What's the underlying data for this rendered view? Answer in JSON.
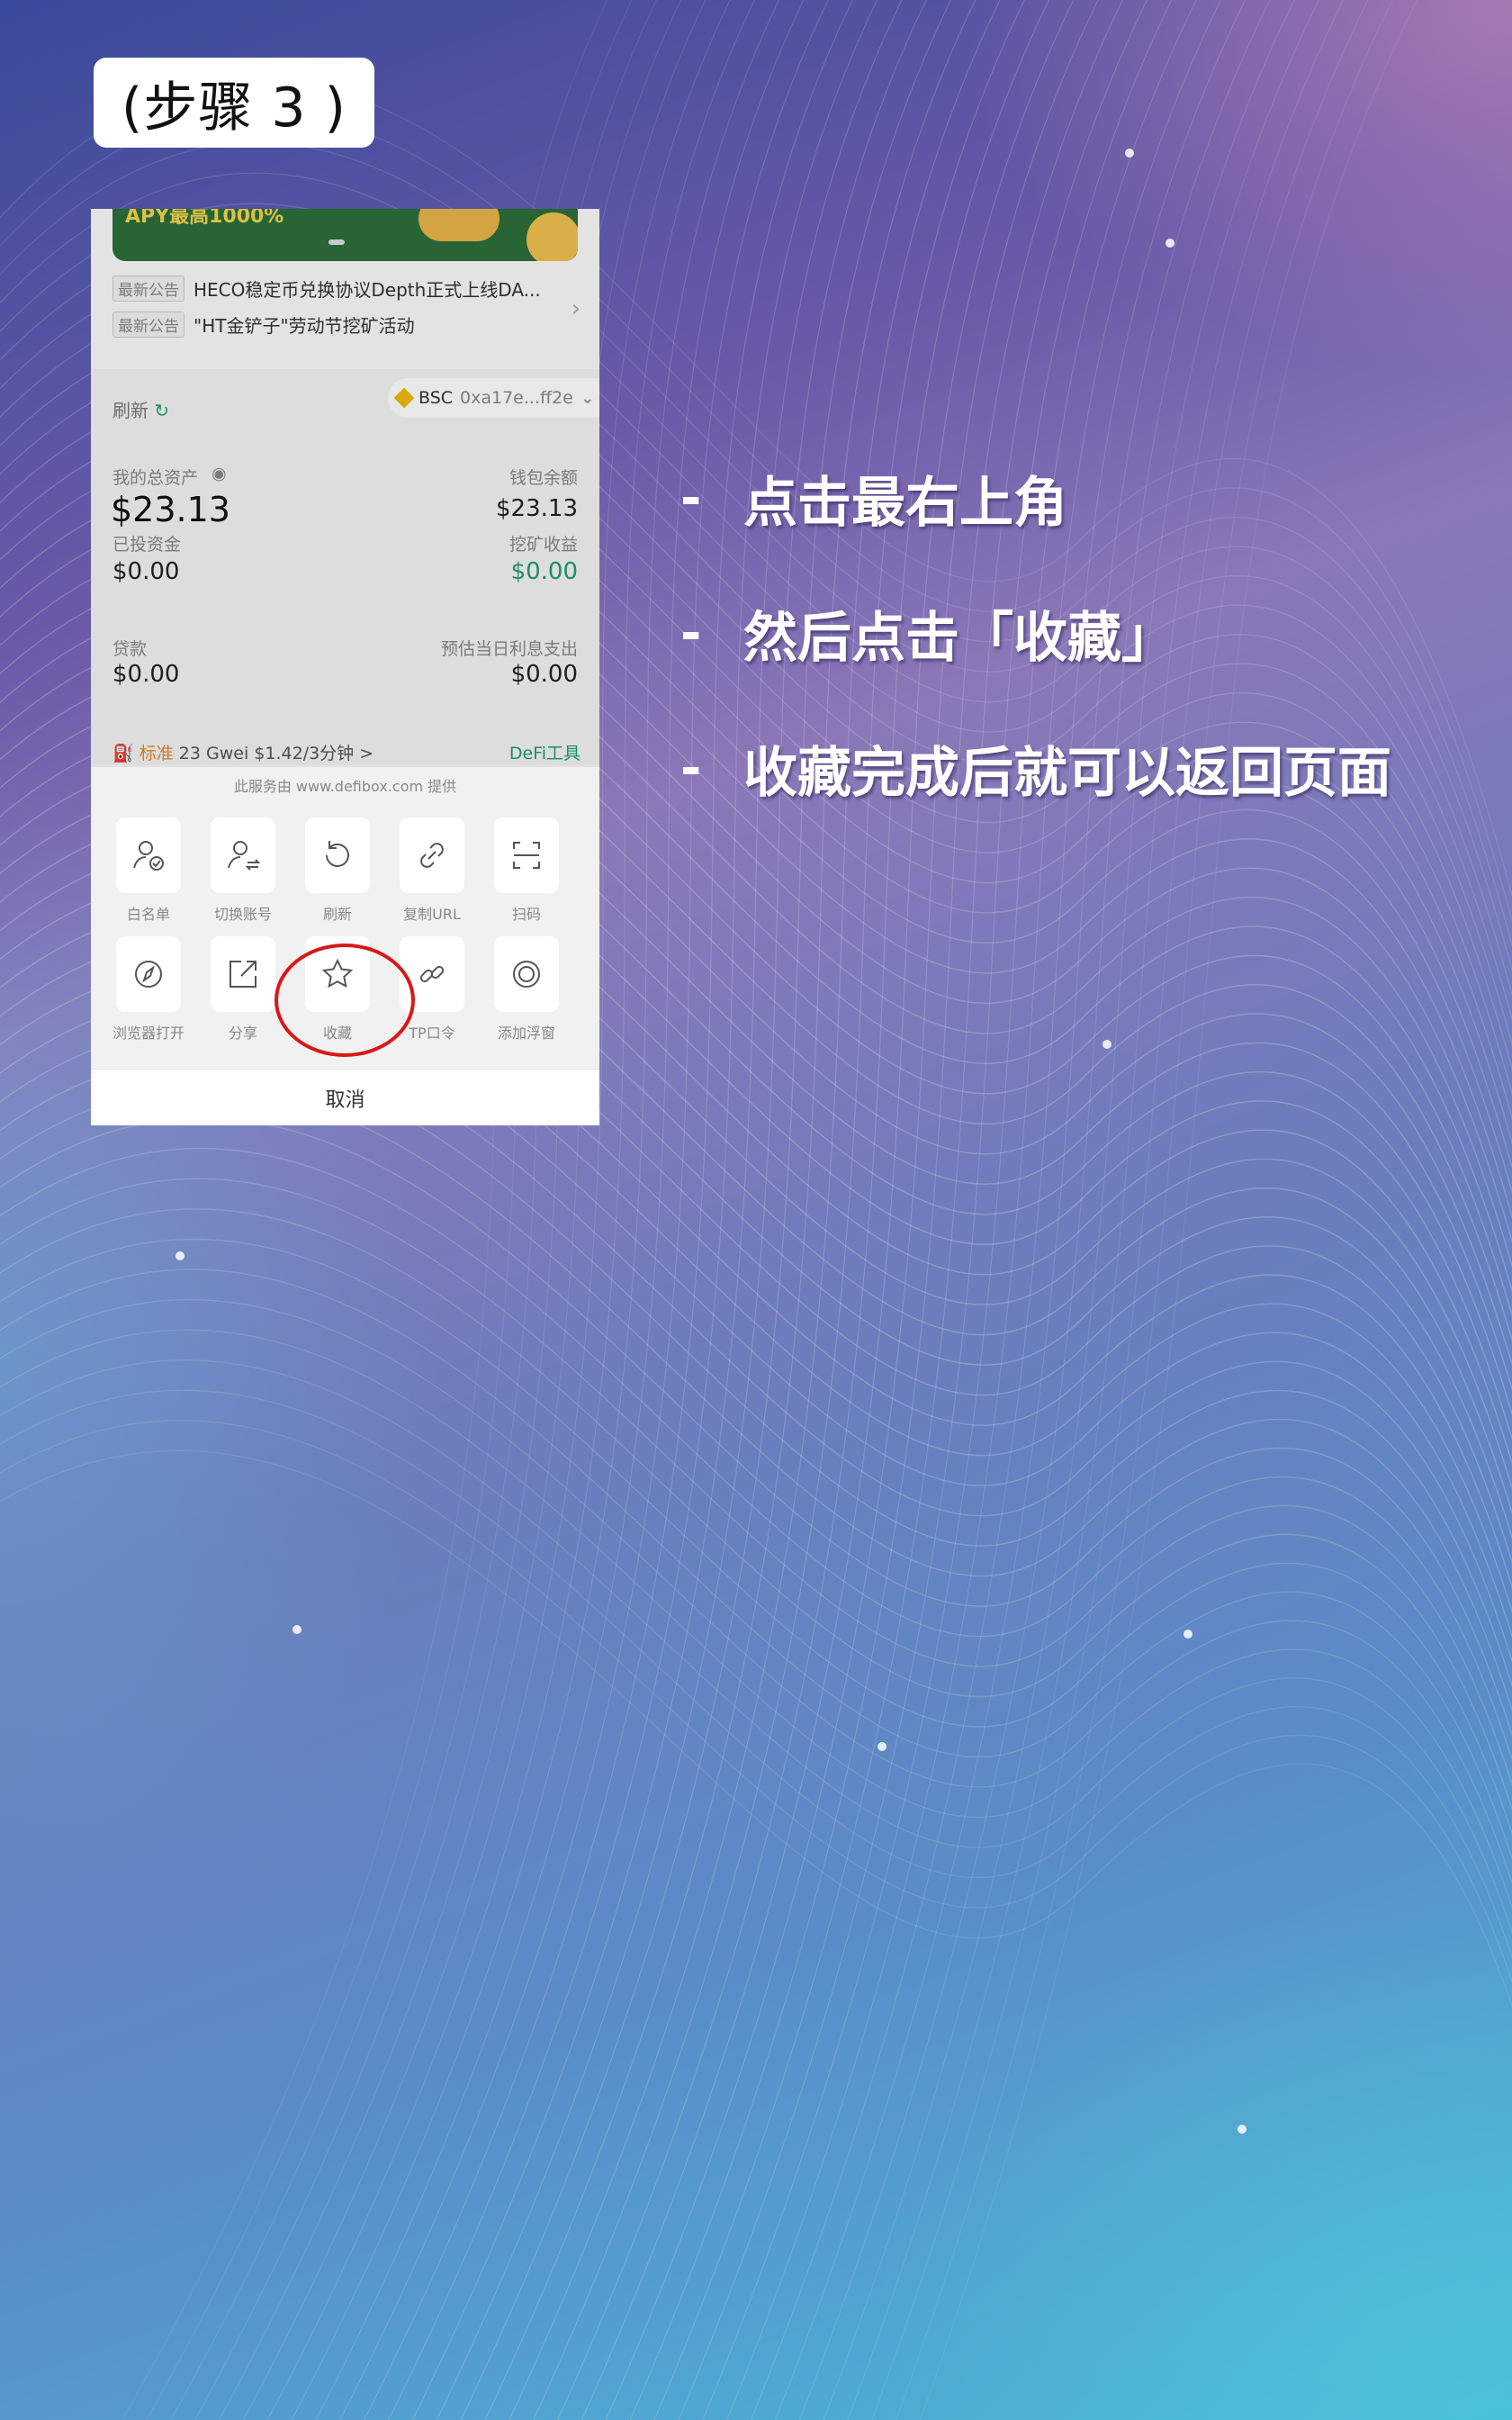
{
  "step_label": "(步骤 3 )",
  "bullets": [
    {
      "dash": "-",
      "text": "点击最右上角"
    },
    {
      "dash": "-",
      "text": "然后点击「收藏」"
    },
    {
      "dash": "-",
      "text": "收藏完成后就可以返回页面"
    }
  ],
  "phone": {
    "banner_text": "APY最高1000%",
    "notices": [
      {
        "tag": "最新公告",
        "text": "HECO稳定币兑换协议Depth正式上线DA..."
      },
      {
        "tag": "最新公告",
        "text": "\"HT金铲子\"劳动节挖矿活动"
      }
    ],
    "refresh_label": "刷新",
    "network": "BSC",
    "address": "0xa17e...ff2e",
    "total_assets_label": "我的总资产",
    "total_assets_value": "$23.13",
    "wallet_balance_label": "钱包余额",
    "wallet_balance_value": "$23.13",
    "invested_label": "已投资金",
    "invested_value": "$0.00",
    "mining_label": "挖矿收益",
    "mining_value": "$0.00",
    "loan_label": "贷款",
    "loan_value": "$0.00",
    "interest_label": "预估当日利息支出",
    "interest_value": "$0.00",
    "gas_std": "标准",
    "gas_value": "23",
    "gas_unit": "Gwei",
    "gas_cost": "$1.42/3分钟 >",
    "defi_tools": "DeFi工具",
    "provider_text": "此服务由 www.defibox.com 提供",
    "actions": [
      {
        "label": "白名单",
        "icon": "whitelist-icon"
      },
      {
        "label": "切换账号",
        "icon": "switch-account-icon"
      },
      {
        "label": "刷新",
        "icon": "refresh-icon"
      },
      {
        "label": "复制URL",
        "icon": "link-icon"
      },
      {
        "label": "扫码",
        "icon": "scan-icon"
      },
      {
        "label": "浏览器打开",
        "icon": "compass-icon"
      },
      {
        "label": "分享",
        "icon": "share-icon"
      },
      {
        "label": "收藏",
        "icon": "star-icon"
      },
      {
        "label": "TP口令",
        "icon": "chain-icon"
      },
      {
        "label": "添加浮窗",
        "icon": "float-window-icon"
      }
    ],
    "cancel_label": "取消"
  },
  "colors": {
    "highlight_circle": "#d81818",
    "positive": "#1f9d6a",
    "gas_standard": "#e08a2e"
  }
}
